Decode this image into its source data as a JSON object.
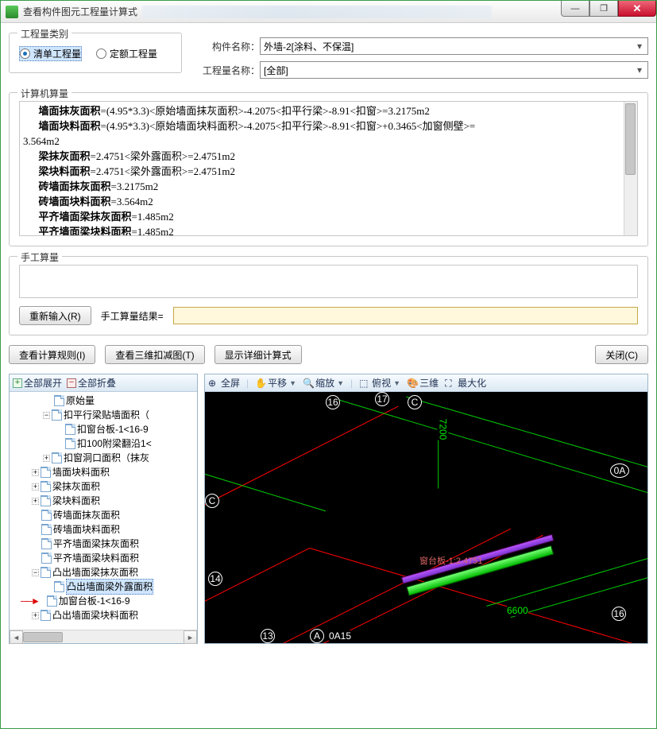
{
  "window": {
    "title": "查看构件图元工程量计算式"
  },
  "sysbuttons": {
    "min": "—",
    "max": "❐",
    "close": "✕"
  },
  "qtyType": {
    "legend": "工程量类别",
    "opt1": "清单工程量",
    "opt2": "定额工程量"
  },
  "selectors": {
    "compLabel": "构件名称：",
    "compValue": "外墙-2[涂料、不保温]",
    "qtyLabel": "工程量名称：",
    "qtyValue": "[全部]"
  },
  "calc": {
    "legend": "计算机算量",
    "l1a": "墙面抹灰面积",
    "l1b": "=(4.95*3.3)<原始墙面抹灰面积>-4.2075<扣平行梁>-8.91<扣窗>=3.2175m2",
    "l2a": "墙面块料面积",
    "l2b": "=(4.95*3.3)<原始墙面块料面积>-4.2075<扣平行梁>-8.91<扣窗>+0.3465<加窗侧壁>=",
    "l2c": "3.564m2",
    "l3a": "梁抹灰面积",
    "l3b": "=2.4751<梁外露面积>=2.4751m2",
    "l4a": "梁块料面积",
    "l4b": "=2.4751<梁外露面积>=2.4751m2",
    "l5a": "砖墙面抹灰面积",
    "l5b": "=3.2175m2",
    "l6a": "砖墙面块料面积",
    "l6b": "=3.564m2",
    "l7a": "平齐墙面梁抹灰面积",
    "l7b": "=1.485m2",
    "l8a": "平齐墙面梁块料面积",
    "l8b": "=1.485m2"
  },
  "manual": {
    "legend": "手工算量",
    "reenter": "重新输入(R)",
    "resultLabel": "手工算量结果="
  },
  "actions": {
    "rule": "查看计算规则(I)",
    "deduct": "查看三维扣减图(T)",
    "detail": "显示详细计算式",
    "close": "关闭(C)"
  },
  "treehdr": {
    "expand": "全部展开",
    "collapse": "全部折叠"
  },
  "tree": {
    "n1": "原始量",
    "n2": "扣平行梁贴墙面积（",
    "n3": "扣窗台板-1<16-9",
    "n4": "扣100附梁翻沿1<",
    "n5": "扣窗洞口面积（抹灰",
    "n6": "墙面块料面积",
    "n7": "梁抹灰面积",
    "n8": "梁块料面积",
    "n9": "砖墙面抹灰面积",
    "n10": "砖墙面块料面积",
    "n11": "平齐墙面梁抹灰面积",
    "n12": "平齐墙面梁块料面积",
    "n13": "凸出墙面梁抹灰面积",
    "n14": "凸出墙面梁外露面积",
    "n15": "加窗台板-1<16-9",
    "n16": "凸出墙面梁块料面积"
  },
  "viewtb": {
    "full": "全屏",
    "pan": "平移",
    "zoom": "缩放",
    "top": "俯视",
    "iso": "三维",
    "max": "最大化"
  },
  "axes": {
    "a16t": "16",
    "a17": "17",
    "aC": "C",
    "a0A": "0A",
    "aCl": "C",
    "a14": "14",
    "a16b": "16",
    "a13": "13",
    "aA": "A",
    "a0A15": "0A15",
    "d7200": "7200",
    "d6600": "6600"
  },
  "anno": "窗台板-1:2.4751"
}
